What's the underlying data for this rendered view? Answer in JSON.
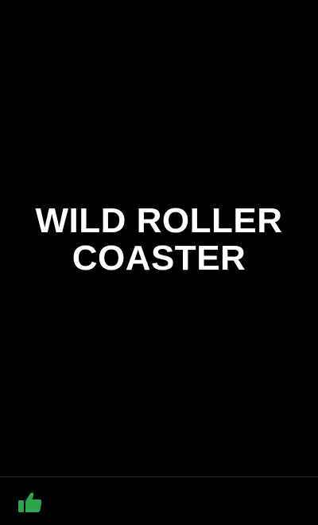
{
  "title": {
    "line1": "WILD ROLLER",
    "line2": "COASTER"
  },
  "footer": {
    "like_icon": "thumbs-up-icon",
    "like_color": "#2ea44f"
  }
}
